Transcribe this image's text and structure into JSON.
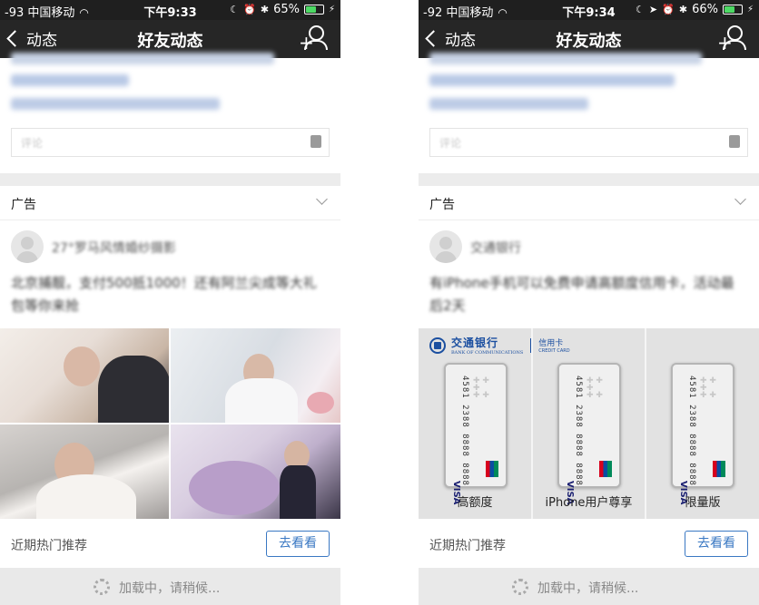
{
  "left": {
    "status_bar": {
      "signal": "-93 中国移动",
      "time": "下午9:33",
      "battery": "65%",
      "battery_level": 0.65
    },
    "nav": {
      "back_label": "动态",
      "title": "好友动态"
    },
    "comment": {
      "placeholder": "评论"
    },
    "ad": {
      "label": "广告",
      "author": "27°罗马风情婚纱摄影",
      "text": "北京捕靓，支付500抵1000！还有阿兰尖成等大礼包等你来抢"
    },
    "recommend": {
      "label": "近期热门推荐",
      "button": "去看看"
    },
    "loading": "加载中，请稍候..."
  },
  "right": {
    "status_bar": {
      "signal": "-92 中国移动",
      "time": "下午9:34",
      "battery": "66%",
      "battery_level": 0.66
    },
    "nav": {
      "back_label": "动态",
      "title": "好友动态"
    },
    "comment": {
      "placeholder": "评论"
    },
    "ad": {
      "label": "广告",
      "author": "交通银行",
      "text": "有iPhone手机可以免费申请高额度信用卡，活动最后2天",
      "bank": {
        "name_cn": "交通银行",
        "name_en": "BANK OF COMMUNICATIONS",
        "card_label": "信用卡",
        "card_label_en": "CREDIT CARD",
        "card_number": "4581 2388 8888 8888",
        "captions": [
          "高额度",
          "iPhone用户尊享",
          "限量版"
        ]
      }
    },
    "recommend": {
      "label": "近期热门推荐",
      "button": "去看看"
    },
    "loading": "加载中，请稍候..."
  },
  "colors": {
    "nav_bg": "#262626",
    "link_blue": "#3a78c3",
    "separator": "#ececec"
  },
  "icons": {
    "back": "chevron-left-icon",
    "add_friend": "add-user-icon",
    "collapse": "chevron-down-icon",
    "delete": "trash-icon",
    "loading": "spinner-icon"
  }
}
